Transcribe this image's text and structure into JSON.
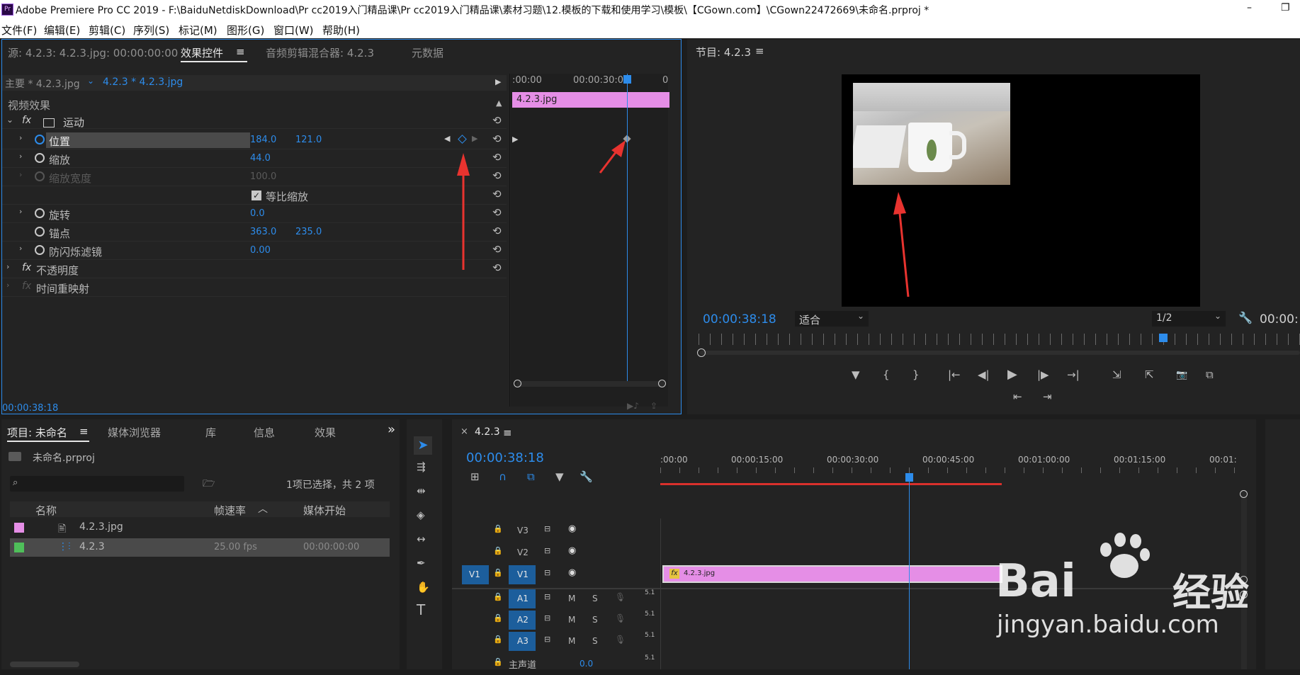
{
  "titlebar": {
    "app_icon": "Pr",
    "title": "Adobe Premiere Pro CC 2019 - F:\\BaiduNetdiskDownload\\Pr cc2019入门精品课\\Pr cc2019入门精品课\\素材习题\\12.模板的下载和使用学习\\模板\\【CGown.com】\\CGown22472669\\未命名.prproj *",
    "minimize": "–",
    "restore": "❐"
  },
  "menu": [
    "文件(F)",
    "编辑(E)",
    "剪辑(C)",
    "序列(S)",
    "标记(M)",
    "图形(G)",
    "窗口(W)",
    "帮助(H)"
  ],
  "effect_controls": {
    "tabs": [
      "源: 4.2.3: 4.2.3.jpg: 00:00:00:00",
      "效果控件",
      "音频剪辑混合器: 4.2.3",
      "元数据"
    ],
    "menu_glyph": "≡",
    "master": "主要 * 4.2.3.jpg",
    "clip": "4.2.3 * 4.2.3.jpg",
    "section": "视频效果",
    "fx": "fx",
    "motion": "运动",
    "props": [
      {
        "name": "位置",
        "v1": "184.0",
        "v2": "121.0"
      },
      {
        "name": "缩放",
        "v1": "44.0",
        "v2": ""
      },
      {
        "name": "缩放宽度",
        "v1": "100.0",
        "v2": ""
      },
      {
        "name": "等比缩放",
        "v1": "",
        "v2": ""
      },
      {
        "name": "旋转",
        "v1": "0.0",
        "v2": ""
      },
      {
        "name": "锚点",
        "v1": "363.0",
        "v2": "235.0"
      },
      {
        "name": "防闪烁滤镜",
        "v1": "0.00",
        "v2": ""
      }
    ],
    "opacity": "不透明度",
    "time_remap": "时间重映射",
    "ruler": [
      ":00:00",
      "00:00:30:00",
      "0"
    ],
    "clip_bar": "4.2.3.jpg",
    "timecode": "00:00:38:18"
  },
  "program": {
    "title": "节目: 4.2.3",
    "menu_glyph": "≡",
    "timecode": "00:00:38:18",
    "fit": "适合",
    "resolution": "1/2",
    "timecode_right": "00:00:",
    "transport_row1": [
      "▼",
      "{",
      "}",
      "|←",
      "◀|",
      "▶",
      "|▶",
      "→|",
      "⇲",
      "⇱",
      "📷",
      "⧉"
    ],
    "transport_row2": [
      "⇤",
      "⇥"
    ]
  },
  "project": {
    "tabs": [
      "项目: 未命名",
      "媒体浏览器",
      "库",
      "信息",
      "效果"
    ],
    "more": "»",
    "file": "未命名.prproj",
    "search_placeholder": "",
    "selection": "1项已选择，共 2 项",
    "columns": [
      "名称",
      "帧速率",
      "媒体开始"
    ],
    "rows": [
      {
        "name": "4.2.3.jpg",
        "fps": "",
        "start": "",
        "color": "#e58ee6"
      },
      {
        "name": "4.2.3",
        "fps": "25.00 fps",
        "start": "00:00:00:00",
        "color": "#4fbf5a"
      }
    ]
  },
  "timeline": {
    "close": "×",
    "title": "4.2.3",
    "menu_glyph": "≡",
    "timecode": "00:00:38:18",
    "ruler": [
      ":00:00",
      "00:00:15:00",
      "00:00:30:00",
      "00:00:45:00",
      "00:01:00:00",
      "00:01:15:00",
      "00:01:"
    ],
    "tracks": [
      {
        "name": "V3",
        "src": "",
        "type": "video"
      },
      {
        "name": "V2",
        "src": "",
        "type": "video"
      },
      {
        "name": "V1",
        "src": "V1",
        "type": "video"
      },
      {
        "name": "A1",
        "src": "",
        "type": "audio"
      },
      {
        "name": "A2",
        "src": "",
        "type": "audio"
      },
      {
        "name": "A3",
        "src": "",
        "type": "audio"
      }
    ],
    "master": "主声道",
    "master_value": "0.0",
    "clip": "4.2.3.jpg",
    "fx": "fx",
    "m": "M",
    "s": "S",
    "ch": "5.1"
  },
  "watermark": {
    "line1": "Bai",
    "line1b": "经验",
    "line2": "jingyan.baidu.com"
  },
  "colors": {
    "accent": "#2d8ceb",
    "clip": "#e58ee6",
    "panel": "#232323",
    "red_arrow": "#e8332f"
  }
}
